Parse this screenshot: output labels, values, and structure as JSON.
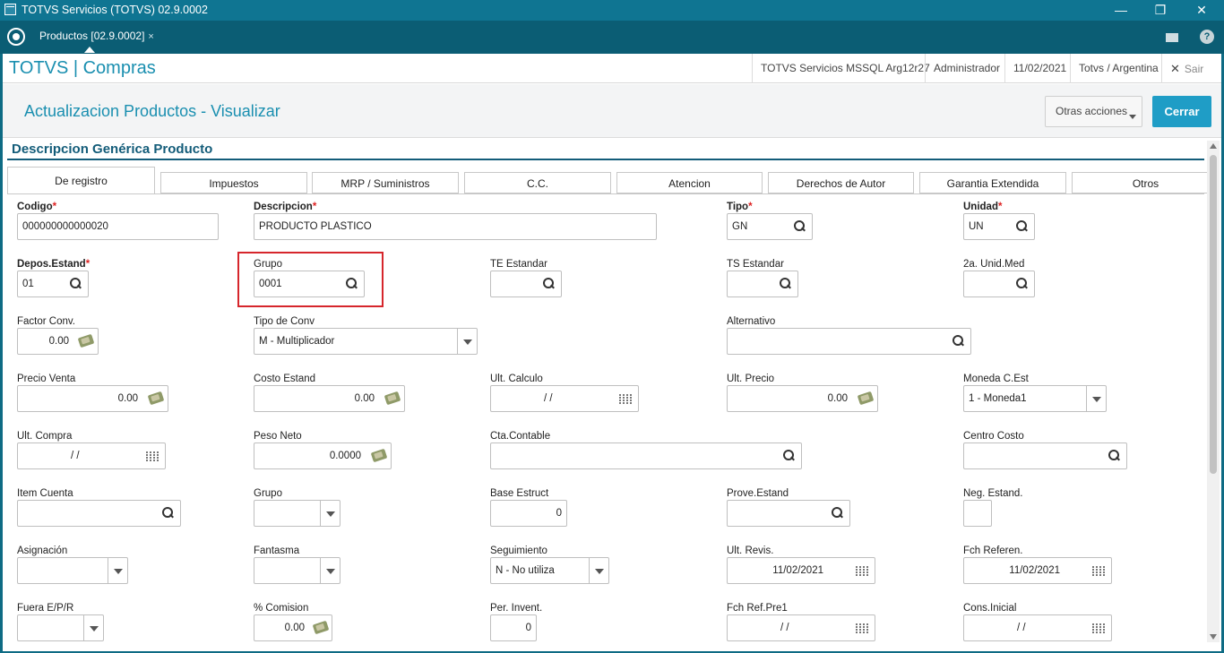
{
  "window": {
    "title": "TOTVS Servicios (TOTVS) 02.9.0002",
    "min": "—",
    "restore": "❐",
    "close": "✕"
  },
  "tabs_strip": {
    "program_tab": "Productos [02.9.0002]",
    "close_mark": "×"
  },
  "header": {
    "brand": "TOTVS | Compras",
    "server": "TOTVS Servicios MSSQL Arg12r27",
    "user": "Administrador",
    "date": "11/02/2021",
    "company": "Totvs / Argentina",
    "exit_icon": "✕",
    "exit_label": "Sair"
  },
  "page": {
    "title": "Actualizacion Productos - Visualizar",
    "more_actions": "Otras acciones",
    "close": "Cerrar"
  },
  "section_title": "Descripcion Genérica Producto",
  "form_tabs": [
    "De registro",
    "Impuestos",
    "MRP / Suministros",
    "C.C.",
    "Atencion",
    "Derechos de Autor",
    "Garantia Extendida",
    "Otros"
  ],
  "fields": {
    "codigo": {
      "label": "Codigo",
      "value": "000000000000020"
    },
    "descripcion": {
      "label": "Descripcion",
      "value": "PRODUCTO PLASTICO"
    },
    "tipo": {
      "label": "Tipo",
      "value": "GN"
    },
    "unidad": {
      "label": "Unidad",
      "value": "UN"
    },
    "depos": {
      "label": "Depos.Estand",
      "value": "01"
    },
    "grupo": {
      "label": "Grupo",
      "value": "0001"
    },
    "te": {
      "label": "TE Estandar",
      "value": ""
    },
    "ts": {
      "label": "TS Estandar",
      "value": ""
    },
    "unid2": {
      "label": "2a. Unid.Med",
      "value": ""
    },
    "factor": {
      "label": "Factor Conv.",
      "value": "0.00"
    },
    "tipoconv": {
      "label": "Tipo de Conv",
      "value": "M - Multiplicador"
    },
    "alternativo": {
      "label": "Alternativo",
      "value": ""
    },
    "precioventa": {
      "label": "Precio Venta",
      "value": "0.00"
    },
    "costo": {
      "label": "Costo Estand",
      "value": "0.00"
    },
    "ultcalculo": {
      "label": "Ult. Calculo",
      "value": "/ /"
    },
    "ultprecio": {
      "label": "Ult. Precio",
      "value": "0.00"
    },
    "moneda": {
      "label": "Moneda C.Est",
      "value": "1 - Moneda1"
    },
    "ultcompra": {
      "label": "Ult. Compra",
      "value": "/ /"
    },
    "pesoneto": {
      "label": "Peso Neto",
      "value": "0.0000"
    },
    "ctacontable": {
      "label": "Cta.Contable",
      "value": ""
    },
    "centrocosto": {
      "label": "Centro Costo",
      "value": ""
    },
    "itemcuenta": {
      "label": "Item Cuenta",
      "value": ""
    },
    "grupo2": {
      "label": "Grupo",
      "value": ""
    },
    "baseestruct": {
      "label": "Base Estruct",
      "value": "0"
    },
    "proveestand": {
      "label": "Prove.Estand",
      "value": ""
    },
    "negestand": {
      "label": "Neg. Estand.",
      "value": ""
    },
    "asignacion": {
      "label": "Asignación",
      "value": ""
    },
    "fantasma": {
      "label": "Fantasma",
      "value": ""
    },
    "seguimiento": {
      "label": "Seguimiento",
      "value": "N - No utiliza"
    },
    "ultrevis": {
      "label": "Ult. Revis.",
      "value": "11/02/2021"
    },
    "fchreferen": {
      "label": "Fch Referen.",
      "value": "11/02/2021"
    },
    "fuera": {
      "label": "Fuera E/P/R",
      "value": ""
    },
    "comision": {
      "label": "% Comision",
      "value": "0.00"
    },
    "perinvent": {
      "label": "Per. Invent.",
      "value": "0"
    },
    "fchrefpre1": {
      "label": "Fch Ref.Pre1",
      "value": "/ /"
    },
    "consinicial": {
      "label": "Cons.Inicial",
      "value": "/ /"
    }
  }
}
